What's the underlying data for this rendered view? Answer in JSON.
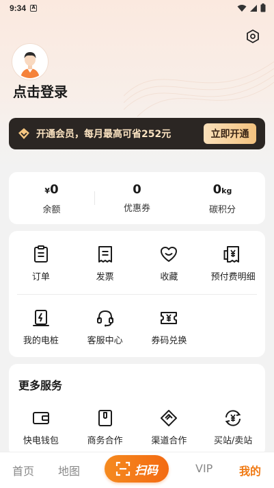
{
  "status_bar": {
    "time": "9:34",
    "a_label": "A"
  },
  "profile": {
    "login_text": "点击登录"
  },
  "vip_banner": {
    "text": "开通会员，每月最高可省252元",
    "button": "立即开通"
  },
  "stats": [
    {
      "prefix": "¥",
      "value": "0",
      "unit": "",
      "label": "余额"
    },
    {
      "prefix": "",
      "value": "0",
      "unit": "",
      "label": "优惠券"
    },
    {
      "prefix": "",
      "value": "0",
      "unit": "kg",
      "label": "碳积分"
    }
  ],
  "orders_grid": {
    "row1": [
      {
        "label": "订单",
        "icon": "clipboard-icon"
      },
      {
        "label": "发票",
        "icon": "receipt-icon"
      },
      {
        "label": "收藏",
        "icon": "heart-icon"
      },
      {
        "label": "预付费明细",
        "icon": "prepaid-receipt-icon"
      }
    ],
    "row2": [
      {
        "label": "我的电桩",
        "icon": "charging-pile-icon"
      },
      {
        "label": "客服中心",
        "icon": "headset-icon"
      },
      {
        "label": "券码兑换",
        "icon": "coupon-icon"
      }
    ]
  },
  "more_services": {
    "title": "更多服务",
    "items": [
      {
        "label": "快电钱包",
        "icon": "wallet-icon"
      },
      {
        "label": "商务合作",
        "icon": "business-icon"
      },
      {
        "label": "渠道合作",
        "icon": "handshake-icon"
      },
      {
        "label": "买站/卖站",
        "icon": "exchange-icon"
      }
    ]
  },
  "tab_bar": {
    "home": "首页",
    "map": "地图",
    "scan": "扫码",
    "vip": "VIP",
    "mine": "我的",
    "active_color": "#f07a14"
  }
}
